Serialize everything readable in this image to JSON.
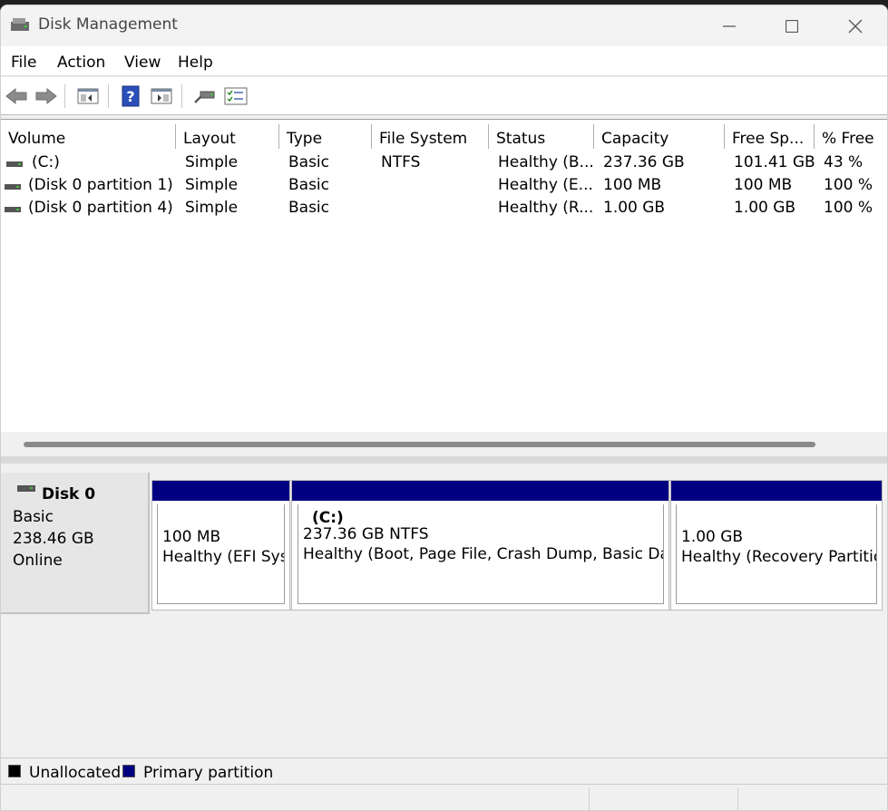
{
  "window": {
    "title": "Disk Management"
  },
  "menu": [
    "File",
    "Action",
    "View",
    "Help"
  ],
  "toolbar": {
    "icons": [
      "back-arrow-icon",
      "forward-arrow-icon",
      "console-tree-icon",
      "help-icon",
      "action-pane-icon",
      "connect-icon",
      "properties-icon"
    ]
  },
  "volume_list": {
    "columns": [
      "Volume",
      "Layout",
      "Type",
      "File System",
      "Status",
      "Capacity",
      "Free Sp...",
      "% Free"
    ],
    "rows": [
      {
        "volume": "(C:)",
        "layout": "Simple",
        "type": "Basic",
        "fs": "NTFS",
        "status": "Healthy (B...",
        "capacity": "237.36 GB",
        "free": "101.41 GB",
        "pct": "43 %"
      },
      {
        "volume": "(Disk 0 partition 1)",
        "layout": "Simple",
        "type": "Basic",
        "fs": "",
        "status": "Healthy (E...",
        "capacity": "100 MB",
        "free": "100 MB",
        "pct": "100 %"
      },
      {
        "volume": "(Disk 0 partition 4)",
        "layout": "Simple",
        "type": "Basic",
        "fs": "",
        "status": "Healthy (R...",
        "capacity": "1.00 GB",
        "free": "1.00 GB",
        "pct": "100 %"
      }
    ]
  },
  "disk": {
    "name": "Disk 0",
    "type": "Basic",
    "size": "238.46 GB",
    "state": "Online",
    "partitions": [
      {
        "label": "",
        "size": "100 MB",
        "status": "Healthy (EFI System Partition)"
      },
      {
        "label": "(C:)",
        "size": "237.36 GB NTFS",
        "status": "Healthy (Boot, Page File, Crash Dump, Basic Data Partition)"
      },
      {
        "label": "",
        "size": "1.00 GB",
        "status": "Healthy (Recovery Partition)"
      }
    ]
  },
  "legend": {
    "unallocated": "Unallocated",
    "primary": "Primary partition",
    "unallocated_color": "#000000",
    "primary_color": "#000080"
  }
}
